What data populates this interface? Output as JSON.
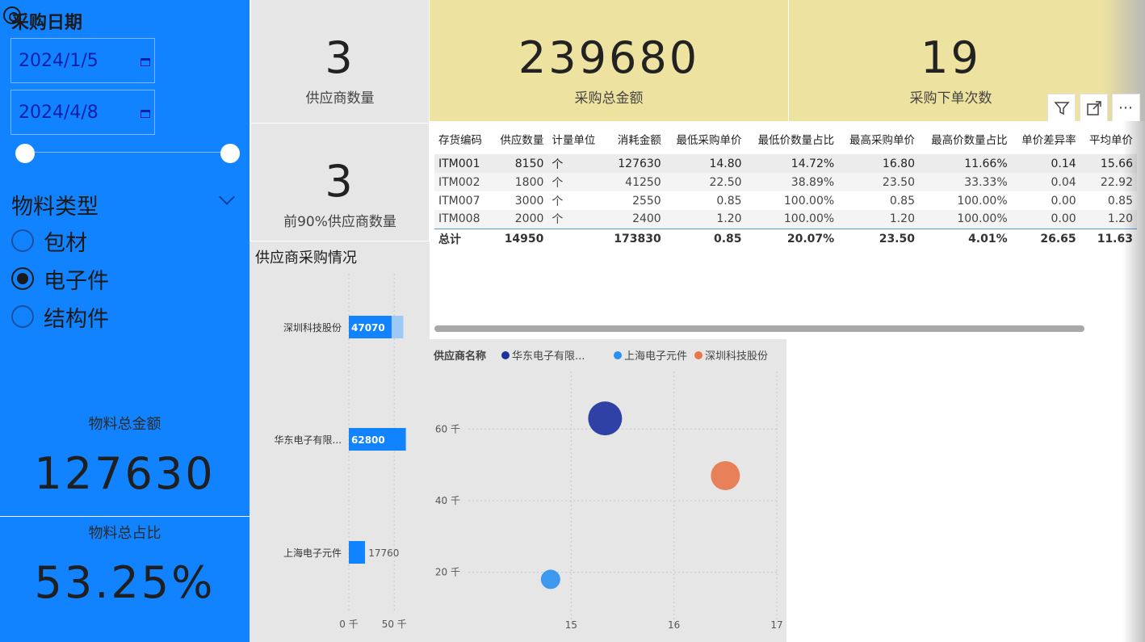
{
  "slicer": {
    "title": "采购日期",
    "start_date": "2024/1/5",
    "end_date": "2024/4/8",
    "material_title": "物料类型",
    "material_options": [
      {
        "label": "包材",
        "selected": false
      },
      {
        "label": "电子件",
        "selected": true
      },
      {
        "label": "结构件",
        "selected": false
      }
    ]
  },
  "kpi": {
    "supplier_count": {
      "value": "3",
      "label": "供应商数量"
    },
    "top90_supplier_count": {
      "value": "3",
      "label": "前90%供应商数量"
    },
    "total_amount": {
      "value": "239680",
      "label": "采购总金额"
    },
    "order_count": {
      "value": "19",
      "label": "采购下单次数"
    },
    "material_total": {
      "value": "127630",
      "label": "物料总金额"
    },
    "material_ratio": {
      "value": "53.25%",
      "label": "物料总占比"
    }
  },
  "visual_header": {
    "icons": [
      "filter-icon",
      "focus-mode-icon",
      "more-options-icon"
    ]
  },
  "table": {
    "columns": [
      "存货编码",
      "供应数量",
      "计量单位",
      "消耗金额",
      "最低采购单价",
      "最低价数量占比",
      "最高采购单价",
      "最高价数量占比",
      "单价差异率",
      "平均单价"
    ],
    "rows": [
      [
        "ITM001",
        "8150",
        "个",
        "127630",
        "14.80",
        "14.72%",
        "16.80",
        "11.66%",
        "0.14",
        "15.66"
      ],
      [
        "ITM002",
        "1800",
        "个",
        "41250",
        "22.50",
        "38.89%",
        "23.50",
        "33.33%",
        "0.04",
        "22.92"
      ],
      [
        "ITM007",
        "3000",
        "个",
        "2550",
        "0.85",
        "100.00%",
        "0.85",
        "100.00%",
        "0.00",
        "0.85"
      ],
      [
        "ITM008",
        "2000",
        "个",
        "2400",
        "1.20",
        "100.00%",
        "1.20",
        "100.00%",
        "0.00",
        "1.20"
      ]
    ],
    "total": [
      "总计",
      "14950",
      "",
      "173830",
      "0.85",
      "20.07%",
      "23.50",
      "4.01%",
      "26.65",
      "11.63"
    ]
  },
  "chart_data": [
    {
      "type": "bar",
      "title": "供应商采购情况",
      "categories": [
        "深圳科技股份",
        "华东电子有限...",
        "上海电子元件"
      ],
      "series": [
        {
          "values": [
            47070,
            62800,
            17760
          ],
          "color": "#1283ff"
        },
        {
          "values": [
            60000,
            57000,
            18000
          ],
          "color": "#9ec9f5"
        }
      ],
      "data_labels": [
        "47070",
        "62800",
        "17760"
      ],
      "xticks": [
        "0 千",
        "50 千"
      ],
      "xlim": [
        0,
        120000
      ],
      "grid": true
    },
    {
      "type": "scatter",
      "legend_title": "供应商名称",
      "legend_position": "top-left",
      "series": [
        {
          "name": "华东电子有限...",
          "color": "#1c2f9f",
          "x": 15.33,
          "y": 63000,
          "size": 21
        },
        {
          "name": "上海电子元件",
          "color": "#2a8ff0",
          "x": 14.8,
          "y": 18000,
          "size": 12
        },
        {
          "name": "深圳科技股份",
          "color": "#e8764a",
          "x": 16.5,
          "y": 47000,
          "size": 18
        }
      ],
      "xticks": [
        "15",
        "16",
        "17"
      ],
      "yticks": [
        "20 千",
        "40 千",
        "60 千"
      ],
      "xlim": [
        14.0,
        17.0
      ],
      "ylim": [
        5000,
        75000
      ],
      "grid": true
    }
  ]
}
